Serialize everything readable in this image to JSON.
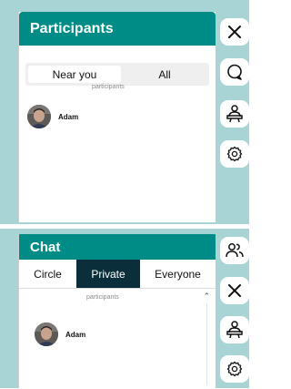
{
  "participants_panel": {
    "title": "Participants",
    "tabs": [
      "Near you",
      "All"
    ],
    "active_tab": "Near you",
    "section_label": "participants",
    "people": [
      {
        "name": "Adam"
      }
    ]
  },
  "chat_panel": {
    "title": "Chat",
    "tabs": [
      "Circle",
      "Private",
      "Everyone"
    ],
    "active_tab": "Private",
    "section_label": "participants",
    "people": [
      {
        "name": "Adam"
      }
    ]
  },
  "sidebar_top": {
    "icons": [
      "close-icon",
      "chat-bubble-icon",
      "presenter-icon",
      "settings-icon"
    ]
  },
  "sidebar_bottom": {
    "icons": [
      "participants-icon",
      "close-icon",
      "presenter-icon",
      "settings-icon"
    ]
  },
  "colors": {
    "header": "#008c86",
    "active_tab": "#0b2f3a",
    "background": "#a9d4d5"
  }
}
